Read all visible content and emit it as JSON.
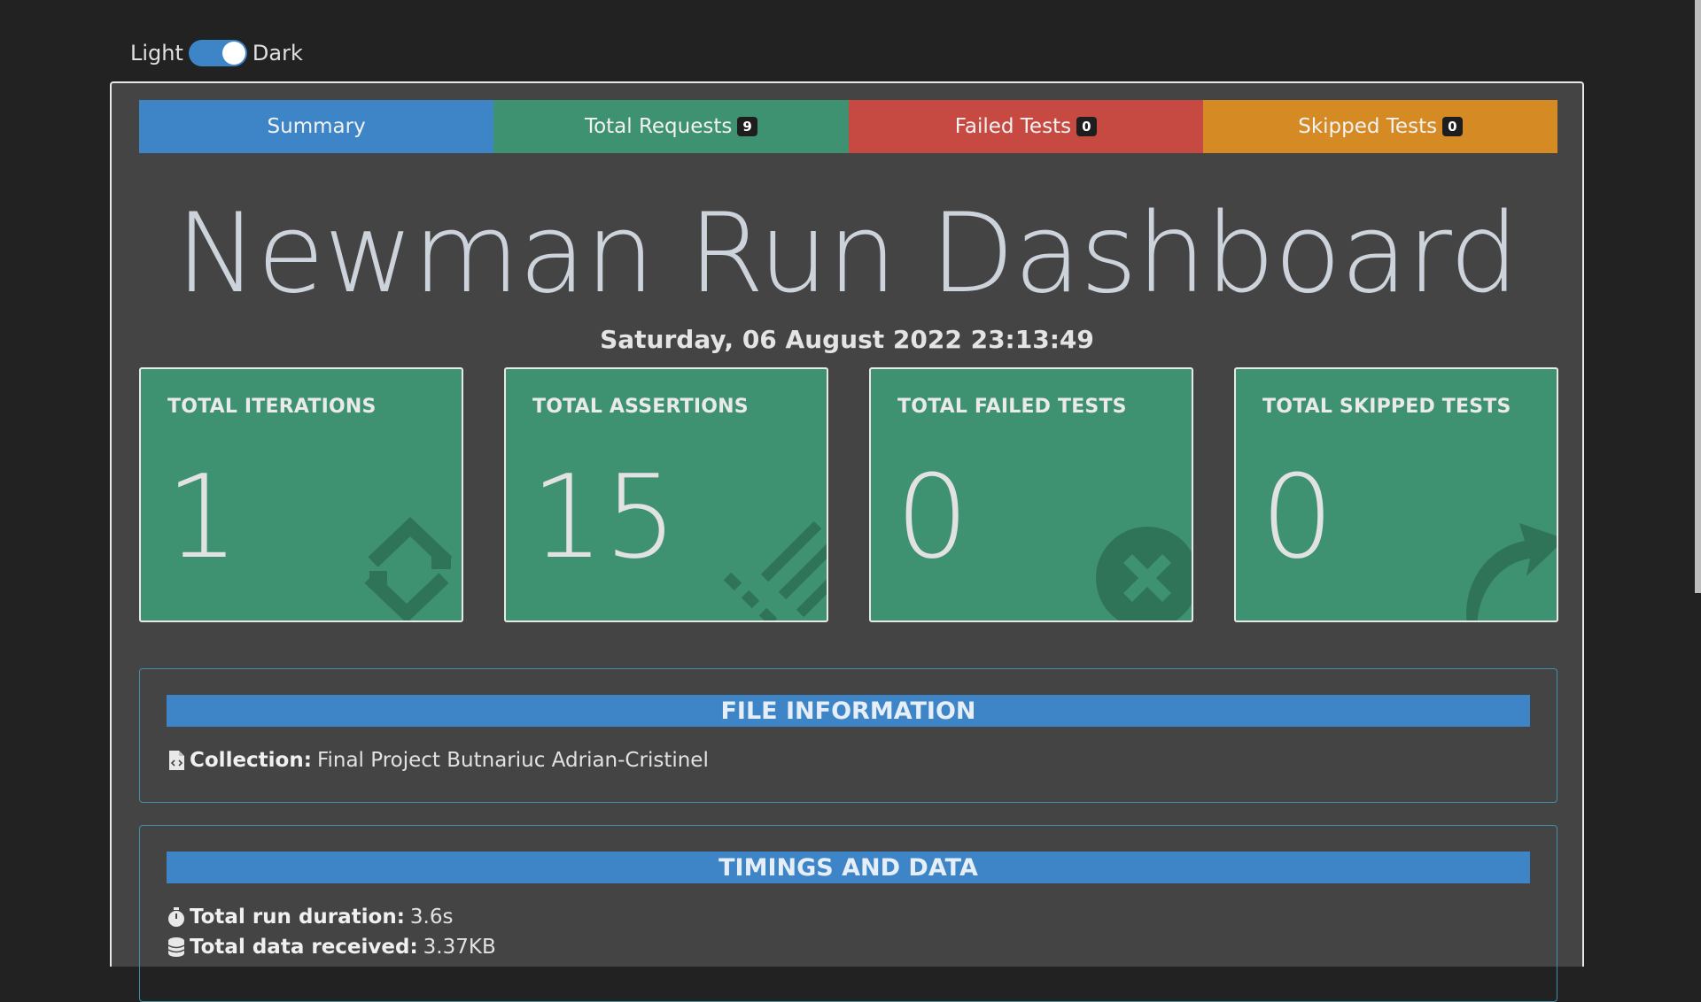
{
  "theme_toggle": {
    "light_label": "Light",
    "dark_label": "Dark"
  },
  "tabs": [
    {
      "label": "Summary",
      "badge": ""
    },
    {
      "label": "Total Requests",
      "badge": "9"
    },
    {
      "label": "Failed Tests",
      "badge": "0"
    },
    {
      "label": "Skipped Tests",
      "badge": "0"
    }
  ],
  "title": "Newman Run Dashboard",
  "date": "Saturday, 06 August 2022 23:13:49",
  "cards": [
    {
      "label": "TOTAL ITERATIONS",
      "value": "1",
      "icon": "sync-icon"
    },
    {
      "label": "TOTAL ASSERTIONS",
      "value": "15",
      "icon": "tasks-icon"
    },
    {
      "label": "TOTAL FAILED TESTS",
      "value": "0",
      "icon": "times-circle-icon"
    },
    {
      "label": "TOTAL SKIPPED TESTS",
      "value": "0",
      "icon": "share-arrow-icon"
    }
  ],
  "file_info": {
    "header": "FILE INFORMATION",
    "collection_label": "Collection:",
    "collection_value": "Final Project Butnariuc Adrian-Cristinel"
  },
  "timings": {
    "header": "TIMINGS AND DATA",
    "duration_label": "Total run duration:",
    "duration_value": "3.6s",
    "received_label": "Total data received:",
    "received_value": "3.37KB"
  },
  "colors": {
    "summary": "#3d85c6",
    "requests": "#3e9272",
    "failed": "#c64a42",
    "skipped": "#d68a24",
    "card": "#3e9272"
  }
}
